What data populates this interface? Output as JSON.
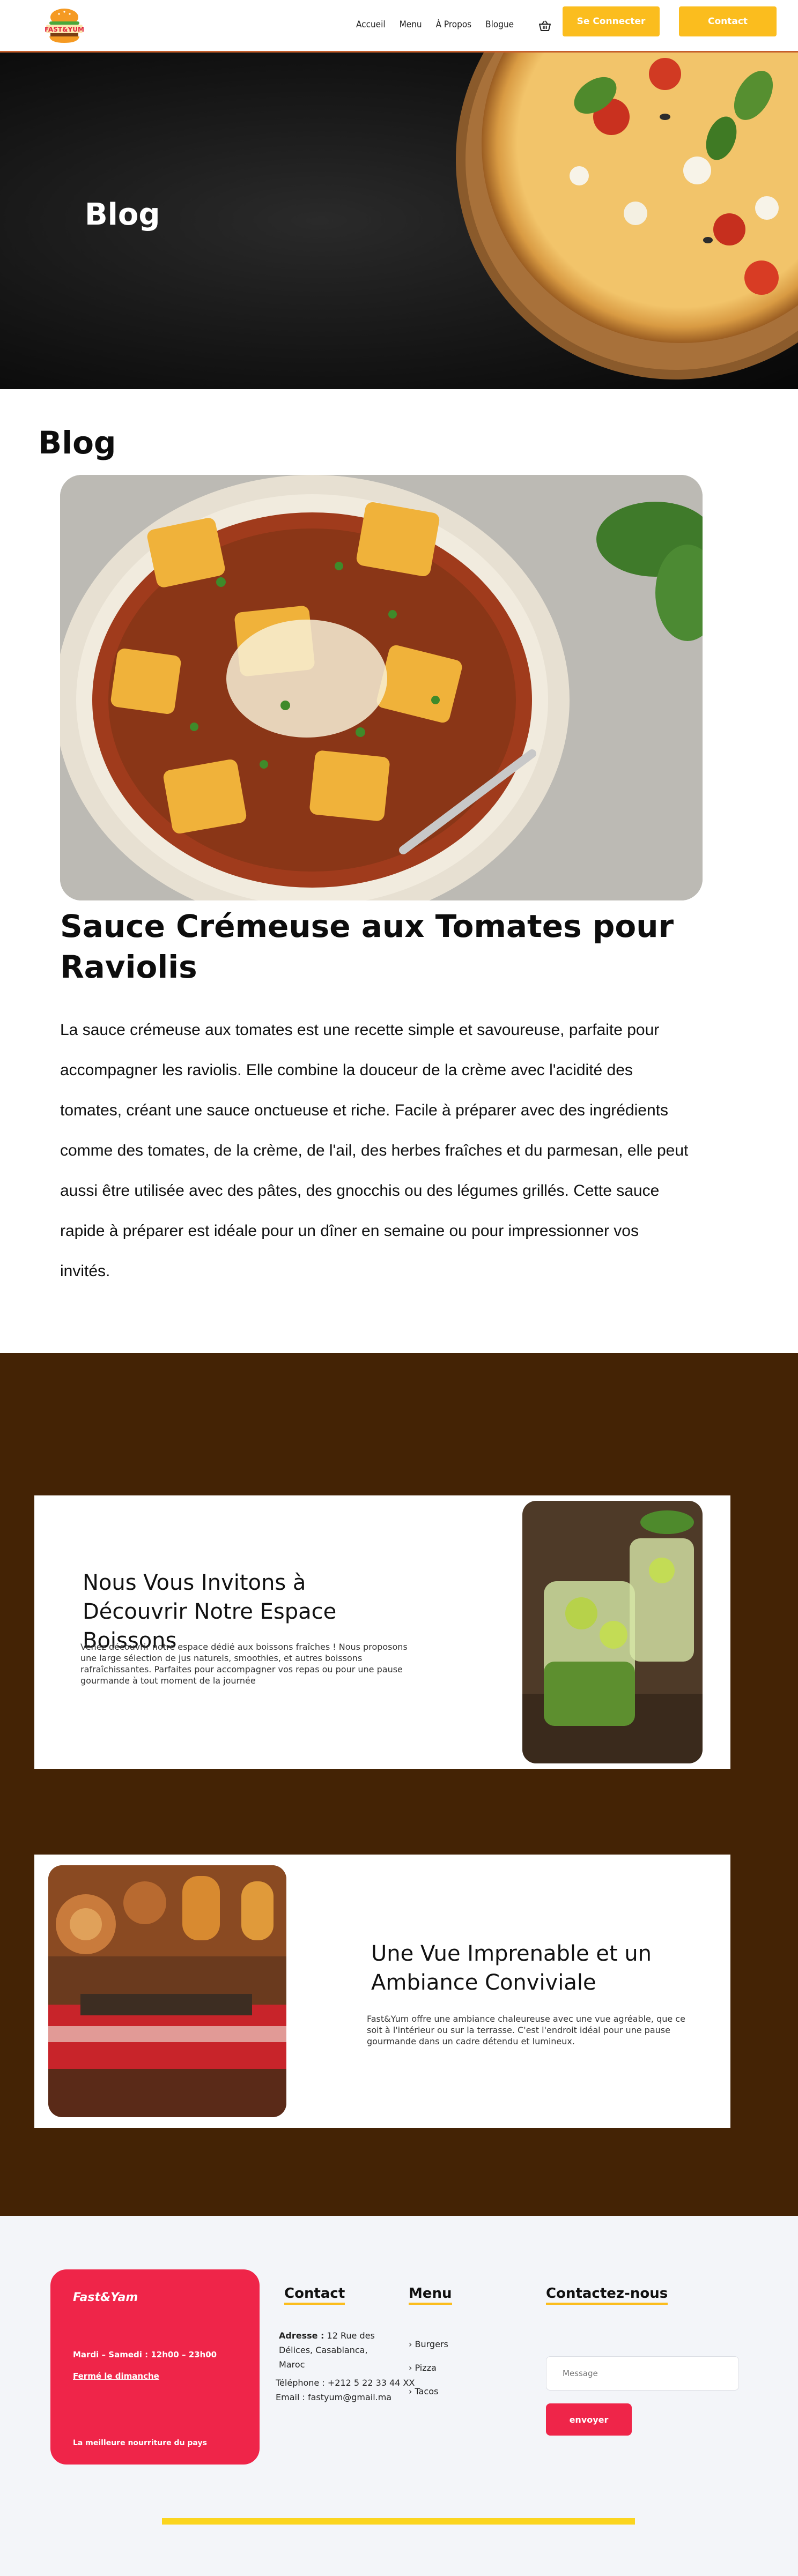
{
  "nav": {
    "logo_text": "FAST&YUM",
    "links": [
      "Accueil",
      "Menu",
      "À Propos",
      "Blogue"
    ],
    "login_label": "Se Connecter",
    "contact_label": "Contact"
  },
  "hero": {
    "title": "Blog"
  },
  "blog": {
    "heading": "Blog",
    "article_title": "Sauce Crémeuse aux Tomates pour Raviolis",
    "article_body": "La sauce crémeuse aux tomates est une recette simple et savoureuse, parfaite pour accompagner les raviolis. Elle combine la douceur de la crème avec l'acidité des tomates, créant une sauce onctueuse et riche. Facile à préparer avec des ingrédients comme des tomates, de la crème, de l'ail, des herbes fraîches et du parmesan, elle peut aussi être utilisée avec des pâtes, des gnocchis ou des légumes grillés. Cette sauce rapide à préparer est idéale pour un dîner en semaine ou pour impressionner vos invités."
  },
  "features": [
    {
      "title": "Nous Vous Invitons à Découvrir Notre Espace Boissons",
      "text": "Venez découvrir notre espace dédié aux boissons fraîches ! Nous proposons une large sélection de jus naturels, smoothies, et autres boissons rafraîchissantes. Parfaites pour accompagner vos repas ou pour une pause gourmande à tout moment de la journée"
    },
    {
      "title": "Une Vue Imprenable et un Ambiance Conviviale",
      "text": "Fast&Yum offre une ambiance chaleureuse avec une vue agréable, que ce soit à l'intérieur ou sur la terrasse. C'est l'endroit idéal pour une pause gourmande dans un cadre détendu et lumineux."
    }
  ],
  "footer": {
    "brand": "Fast&Yam",
    "hours": "Mardi – Samedi : 12h00 – 23h00",
    "closed": "Fermé le dimanche",
    "tagline": "La meilleure nourriture du pays",
    "contact_heading": "Contact",
    "address_label": "Adresse :",
    "address_value": "12 Rue des Délices, Casablanca, Maroc",
    "phone": "Téléphone : +212 5 22 33 44 XX",
    "email": "Email : fastyum@gmail.ma",
    "menu_heading": "Menu",
    "menu_items": [
      "Burgers",
      "Pizza",
      "Tacos"
    ],
    "contactez_heading": "Contactez-nous",
    "message_placeholder": "Message",
    "send_label": "envoyer"
  },
  "colors": {
    "accent_yellow": "#fbbd1e",
    "brown": "#442305",
    "red": "#ef2549",
    "nav_border": "#c55f2c"
  }
}
